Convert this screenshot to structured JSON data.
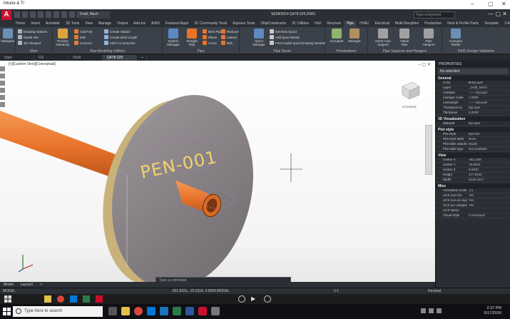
{
  "remote_title": "Intune & Tr",
  "app": {
    "logo": "A",
    "workspace": "Draft, Mech",
    "doc_title": "SE28/2014   Q478-225.DWG",
    "search_placeholder": "Type a keyword",
    "window_controls": "—  ▢  ✕"
  },
  "ribbon_tabs": [
    "Home",
    "Insert",
    "Annotate",
    "3D Tools",
    "View",
    "Manage",
    "Output",
    "Add-ins",
    "A360",
    "Featured Apps",
    "3C Community Tools",
    "Express Tools",
    "ShipConstructor",
    "3C Utilities",
    "Hull",
    "Structure",
    "Pipe",
    "HVAC",
    "Electrical",
    "Multi Discipline",
    "Production",
    "Nest & Profile Parts",
    "Template",
    "3 Assembly Tools"
  ],
  "active_ribbon_tab": "Pipe",
  "ribbon": {
    "navigator": "Navigator",
    "main_title": "Main",
    "main_items": [
      "Drawing Options",
      "Model Info",
      "3D Viewport"
    ],
    "product_hierarchy": "Product Hierarchy",
    "modeling_items": [
      "Add Part",
      "Edit",
      "Connect",
      "Create Station",
      "Create Mod Length",
      "Add 3 Connection"
    ],
    "modeling_title": "Pipe Modeling Utilities",
    "system_manager": "System Manager",
    "straight_pipe": "Straight Pipe",
    "pipe_items": [
      "Bent Pipe",
      "Elbow",
      "Cross",
      "Reducer",
      "Lateral",
      "Bolt"
    ],
    "pipe_title": "Pipe",
    "spool_manager": "Spool Manager",
    "spool_items": [
      "Set New Spool",
      "Add Spool Break",
      "Find Invalid Spool Drawing Number"
    ],
    "spool_title": "Pipe Spool",
    "groupset": "Groupset",
    "manager": "Manager",
    "penetrations_title": "Penetrations",
    "insert_auto_support": "Insert Auto Support",
    "attach_pipe": "Attach Pipe",
    "pipe_hangers": "Pipe Hangers",
    "supports_title": "Pipe Supports and Hangers",
    "compare_to_model": "Compare Model",
    "pid_title": "P&ID Design Validation"
  },
  "doc_tabs": [
    "Start",
    "GS",
    "Shell",
    "Q478-225",
    "+"
  ],
  "active_doc_tab": "Q478-225",
  "viewport": {
    "label": "[+][Custom View][Conceptual]",
    "controls": "– ▢ ✕",
    "penetration_label": "PEN-001",
    "viewcube_label": "Unnamed",
    "command_prompt": "Type a command"
  },
  "properties": {
    "title": "PROPERTIES",
    "selection": "No selection",
    "sections": [
      {
        "name": "General",
        "rows": [
          [
            "Color",
            "■ ByLayer"
          ],
          [
            "Layer",
            "_Draft_Mech"
          ],
          [
            "Linetype",
            "—— ByLayer"
          ],
          [
            "Linetype scale",
            "1.0000"
          ],
          [
            "Lineweight",
            "—— ByLayer"
          ],
          [
            "Transparency",
            "ByLayer"
          ],
          [
            "Thickness",
            "0.0000"
          ]
        ]
      },
      {
        "name": "3D Visualization",
        "rows": [
          [
            "Material",
            "ByLayer"
          ]
        ]
      },
      {
        "name": "Plot style",
        "rows": [
          [
            "Plot style",
            "ByColor"
          ],
          [
            "Plot style table",
            "None"
          ],
          [
            "Plot table attache",
            "Model"
          ],
          [
            "Plot table type",
            "Not available"
          ]
        ]
      },
      {
        "name": "View",
        "rows": [
          [
            "Center X",
            "-65.1206"
          ],
          [
            "Center Y",
            "18.9304"
          ],
          [
            "Center Z",
            "0.0000"
          ],
          [
            "Height",
            "177.8449"
          ],
          [
            "Width",
            "3138.3317"
          ]
        ]
      },
      {
        "name": "Misc",
        "rows": [
          [
            "Annotation scale",
            "1:1"
          ],
          [
            "UCS icon On",
            "Yes"
          ],
          [
            "UCS icon at origin",
            "Yes"
          ],
          [
            "UCS per viewport",
            "Yes"
          ],
          [
            "UCS Name",
            ""
          ],
          [
            "Visual Style",
            "Conceptual"
          ]
        ]
      }
    ]
  },
  "layout_tabs": [
    "Model",
    "Layout1",
    "+"
  ],
  "status": {
    "model": "MODEL",
    "coords": "-301.8331, -22.9119, 0.0000   MODEL",
    "scale": "1:1",
    "decimal": "Decimal"
  },
  "taskbar": {
    "search_placeholder": "Type here to search",
    "time": "2:37 PM",
    "date": "6/17/2016"
  },
  "colors": {
    "accent_red": "#c8102e",
    "pipe_orange": "#e8742a",
    "flange_gray": "#8a8488"
  }
}
